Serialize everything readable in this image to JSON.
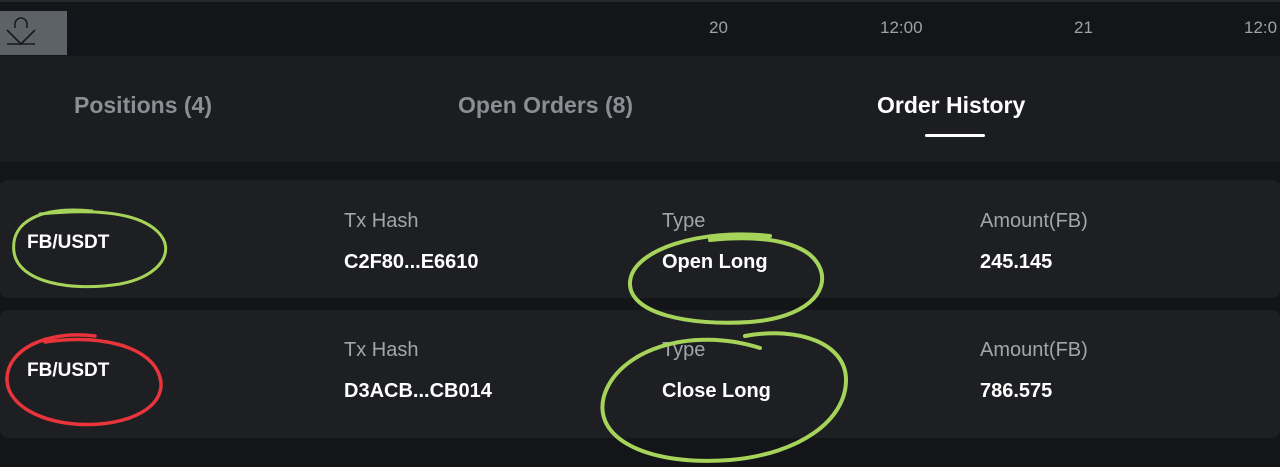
{
  "axis": {
    "ticks": [
      "20",
      "12:00",
      "21",
      "12:0"
    ]
  },
  "tabs": [
    {
      "label": "Positions (4)",
      "active": false
    },
    {
      "label": "Open Orders (8)",
      "active": false
    },
    {
      "label": "Order History",
      "active": true
    }
  ],
  "orders": [
    {
      "pair": "FB/USDT",
      "tx_hash_label": "Tx Hash",
      "tx_hash": "C2F80...E6610",
      "type_label": "Type",
      "type": "Open Long",
      "amount_label": "Amount(FB)",
      "amount": "245.145"
    },
    {
      "pair": "FB/USDT",
      "tx_hash_label": "Tx Hash",
      "tx_hash": "D3ACB...CB014",
      "type_label": "Type",
      "type": "Close Long",
      "amount_label": "Amount(FB)",
      "amount": "786.575"
    }
  ],
  "colors": {
    "background": "#141518",
    "panel": "#1e1f22",
    "annotation_green": "#a6d35a",
    "annotation_red": "#e8343a"
  }
}
